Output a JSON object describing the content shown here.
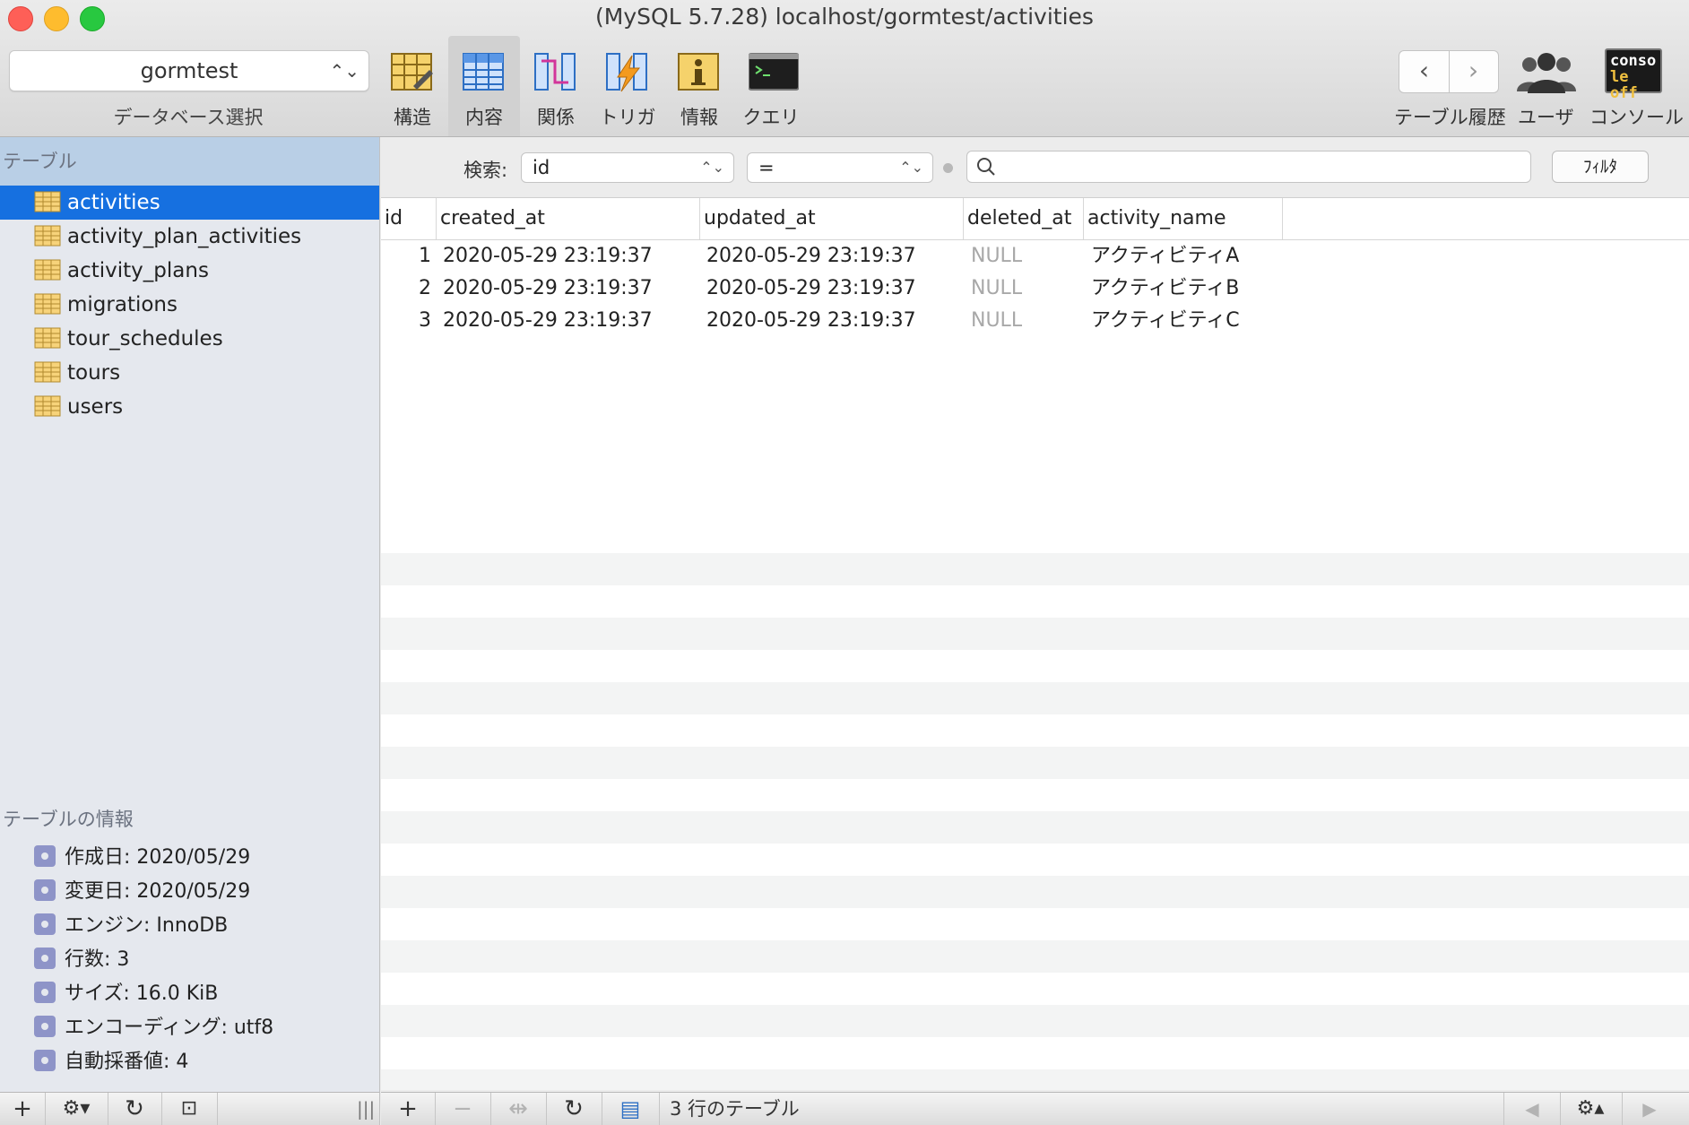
{
  "window": {
    "title": "(MySQL 5.7.28) localhost/gormtest/activities"
  },
  "toolbar": {
    "database": "gormtest",
    "database_caption": "データベース選択",
    "tools": [
      {
        "label": "構造",
        "icon": "structure-icon"
      },
      {
        "label": "内容",
        "icon": "content-icon"
      },
      {
        "label": "関係",
        "icon": "relations-icon"
      },
      {
        "label": "トリガ",
        "icon": "triggers-icon"
      },
      {
        "label": "情報",
        "icon": "info-icon"
      },
      {
        "label": "クエリ",
        "icon": "query-terminal-icon"
      }
    ],
    "active_tool": "内容",
    "history_label": "テーブル履歴",
    "users_label": "ユーザ",
    "console_label": "コンソール",
    "console_icon_text": [
      "conso",
      "le off"
    ]
  },
  "sidebar": {
    "tables_header": "テーブル",
    "tables": [
      "activities",
      "activity_plan_activities",
      "activity_plans",
      "migrations",
      "tour_schedules",
      "tours",
      "users"
    ],
    "selected_table": "activities",
    "info_header": "テーブルの情報",
    "info": [
      "作成日: 2020/05/29",
      "変更日: 2020/05/29",
      "エンジン: InnoDB",
      "行数: 3",
      "サイズ: 16.0 KiB",
      "エンコーディング: utf8",
      "自動採番値: 4"
    ]
  },
  "filter": {
    "label": "検索:",
    "field": "id",
    "operator": "=",
    "search_value": "",
    "button": "ﾌｨﾙﾀ"
  },
  "table": {
    "columns": [
      "id",
      "created_at",
      "updated_at",
      "deleted_at",
      "activity_name"
    ],
    "rows": [
      [
        "1",
        "2020-05-29 23:19:37",
        "2020-05-29 23:19:37",
        "NULL",
        "アクティビティA"
      ],
      [
        "2",
        "2020-05-29 23:19:37",
        "2020-05-29 23:19:37",
        "NULL",
        "アクティビティB"
      ],
      [
        "3",
        "2020-05-29 23:19:37",
        "2020-05-29 23:19:37",
        "NULL",
        "アクティビティC"
      ]
    ]
  },
  "statusbar": {
    "row_count": "3 行のテーブル"
  },
  "colors": {
    "selection": "#1670e0",
    "sidebar_header": "#b9cfe6",
    "null_text": "#a8a8a8"
  }
}
